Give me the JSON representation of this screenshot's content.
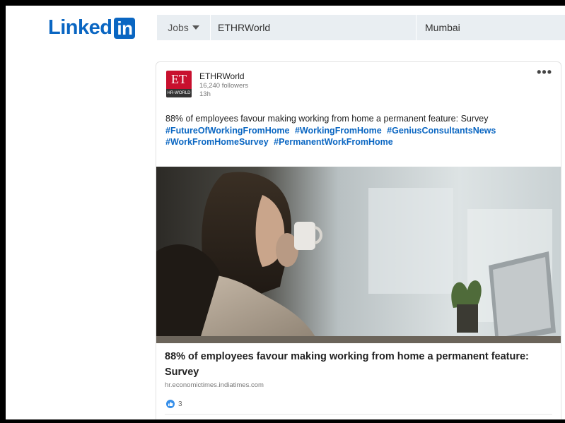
{
  "header": {
    "logo_text": "Linked",
    "logo_badge": "in",
    "search": {
      "category": "Jobs",
      "keyword": "ETHRWorld",
      "location": "Mumbai"
    }
  },
  "post": {
    "author": {
      "logo_text": "ET",
      "logo_subtext": "HR-WORLD",
      "name": "ETHRWorld",
      "followers": "16,240 followers",
      "time": "13h"
    },
    "more_label": "•••",
    "text": "88% of employees favour making working from home a permanent feature: Survey",
    "hashtags": [
      "#FutureOfWorkingFromHome",
      "#WorkingFromHome",
      "#GeniusConsultantsNews",
      "#WorkFromHomeSurvey",
      "#PermanentWorkFromHome"
    ],
    "article": {
      "headline": "88% of employees favour making working from home a permanent feature: Survey",
      "source": "hr.economictimes.indiatimes.com"
    },
    "reactions": {
      "count": "3"
    }
  },
  "colors": {
    "brand": "#0a66c2",
    "et_red": "#c8102e",
    "search_bg": "#e9eef2"
  }
}
